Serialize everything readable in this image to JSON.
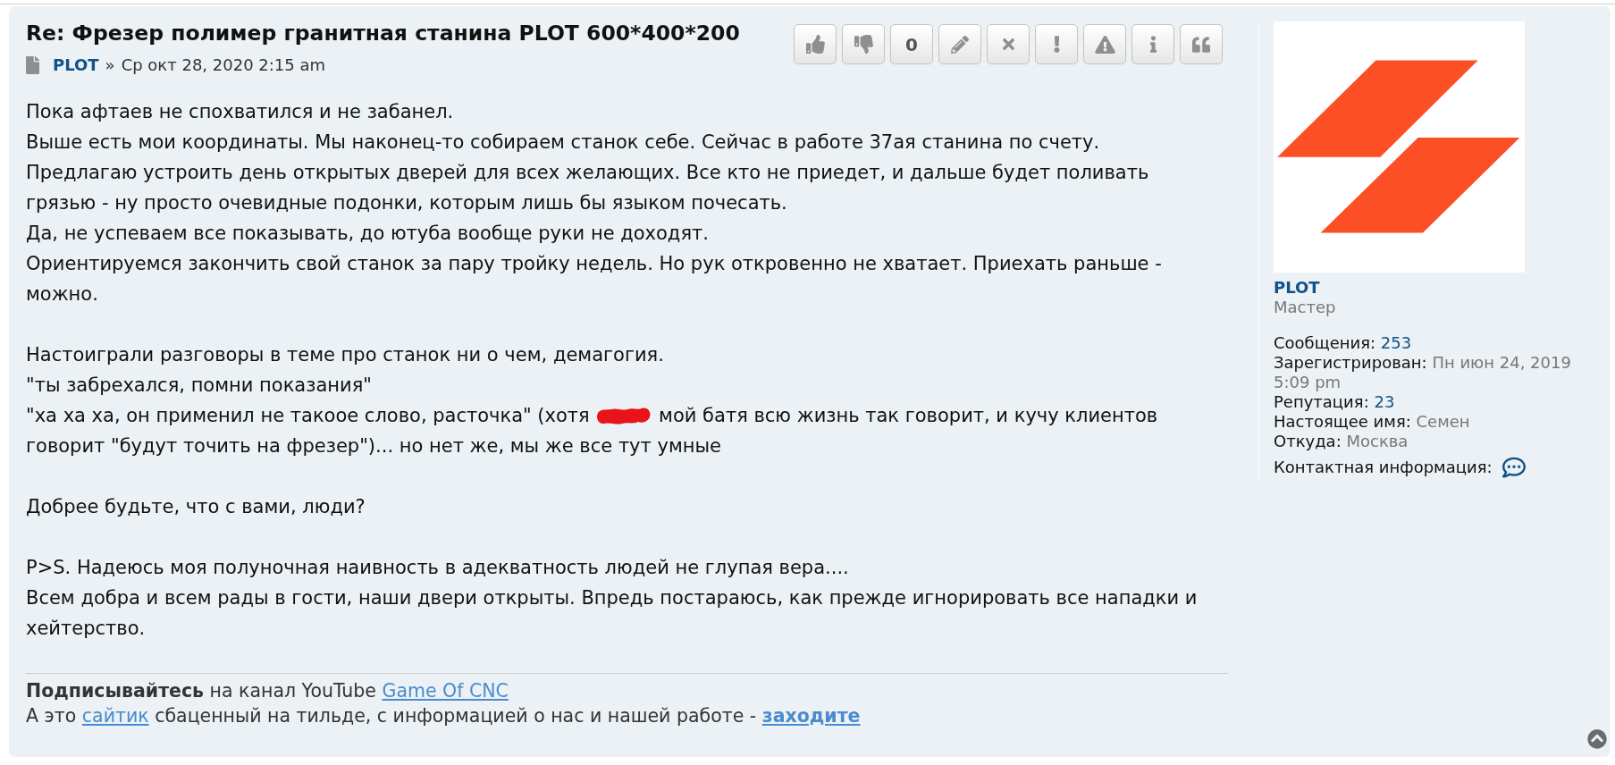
{
  "post": {
    "title": "Re: Фрезер полимер гранитная станина PLOT 600*400*200",
    "author": "PLOT",
    "separator": "»",
    "date": "Ср окт 28, 2020 2:15 am",
    "score": "0",
    "paragraphs": [
      [
        {
          "text": "Пока афтаев не спохватился и не забанел."
        },
        {
          "text": "Выше есть мои координаты. Мы наконец-то собираем станок себе. Сейчас в работе 37ая станина по счету."
        },
        {
          "text": "Предлагаю устроить день открытых дверей для всех желающих. Все кто не приедет, и дальше будет поливать грязью - ну просто очевидные подонки, которым лишь бы языком почесать."
        },
        {
          "text": "Да, не успеваем все показывать, до ютуба вообще руки не доходят."
        },
        {
          "text": "Ориентируемся закончить свой станок за пару тройку недель. Но рук откровенно не хватает. Приехать раньше - можно."
        }
      ],
      [
        {
          "text": "Настоиграли разговоры в теме про станок ни о чем, демагогия."
        },
        {
          "text": "\"ты забрехался, помни показания\""
        },
        {
          "text": "\"ха ха ха, он применил не такоое слово, расточка\" (хотя",
          "redacted": true,
          "after": "мой батя всю жизнь так говорит, и кучу клиентов говорит \"будут точить на фрезер\")... но нет же, мы же все тут умные"
        }
      ],
      [
        {
          "text": "Добрее будьте, что с вами, люди?"
        }
      ],
      [
        {
          "text": "P>S. Надеюсь моя полуночная наивность в адекватность людей не глупая вера...."
        },
        {
          "text": "Всем добра и всем рады в гости, наши двери открыты. Впредь постараюсь, как прежде игнорировать все нападки и хейтерство."
        }
      ]
    ],
    "signature": [
      [
        {
          "kind": "text",
          "text": "**Подписывайтесь** на канал YouTube"
        },
        {
          "kind": "link",
          "text": "Game Of CNC",
          "bold": false
        }
      ],
      [
        {
          "kind": "text",
          "text": "А это"
        },
        {
          "kind": "link",
          "text": "сайтик",
          "bold": false
        },
        {
          "kind": "text",
          "text": "сбаценный на тильде, с информацией о нас и нашей работе -"
        },
        {
          "kind": "link",
          "text": "заходите",
          "bold": true
        }
      ]
    ]
  },
  "profile": {
    "username": "PLOT",
    "rank": "Мастер",
    "fields": [
      {
        "label": "Сообщения:",
        "value": "253",
        "kind": "link"
      },
      {
        "label": "Зарегистрирован:",
        "value": "Пн июн 24, 2019 5:09 pm",
        "kind": "plain"
      },
      {
        "label": "Репутация:",
        "value": "23",
        "kind": "link"
      },
      {
        "label": "Настоящее имя:",
        "value": "Семен",
        "kind": "plain"
      },
      {
        "label": "Откуда:",
        "value": "Москва",
        "kind": "plain"
      }
    ],
    "contact_label": "Контактная информация:"
  }
}
